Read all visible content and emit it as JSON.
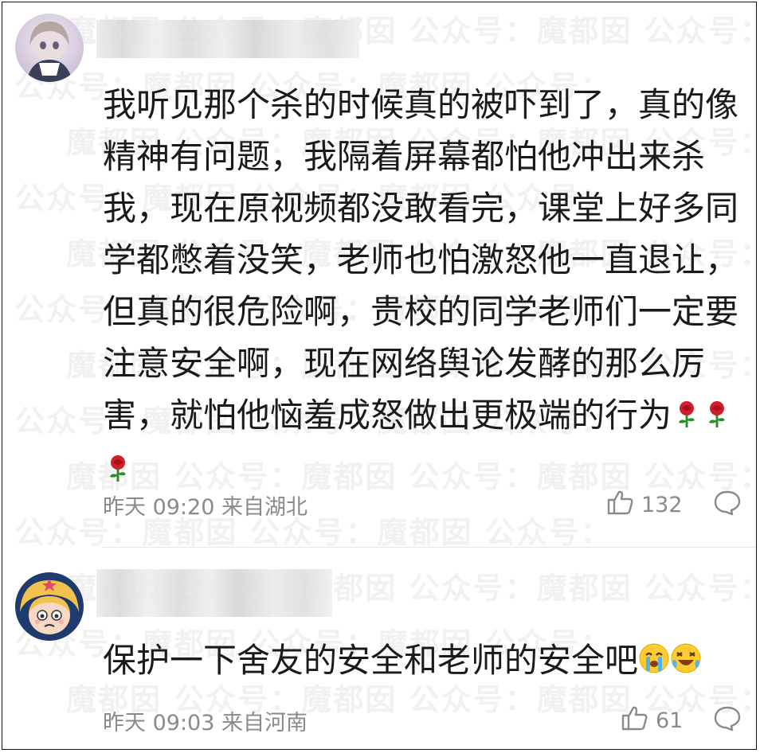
{
  "watermark": "魔都囡 公众号：魔都囡 公众号：魔都囡 公众号：",
  "comments": [
    {
      "text": "我听见那个杀的时候真的被吓到了，真的像精神有问题，我隔着屏幕都怕他冲出来杀我，现在原视频都没敢看完，课堂上好多同学都憋着没笑，老师也怕激怒他一直退让，但真的很危险啊，贵校的同学老师们一定要注意安全啊，现在网络舆论发酵的那么厉害，就怕他恼羞成怒做出更极端的行为",
      "emoji": [
        "rose-emoji",
        "rose-emoji",
        "rose-emoji"
      ],
      "meta": "昨天 09:20 来自湖北",
      "likes": "132"
    },
    {
      "text": "保护一下舍友的安全和老师的安全吧",
      "emoji": [
        "crying-face-emoji",
        "laughing-crying-emoji"
      ],
      "meta": "昨天 09:03 来自河南",
      "likes": "61"
    }
  ]
}
